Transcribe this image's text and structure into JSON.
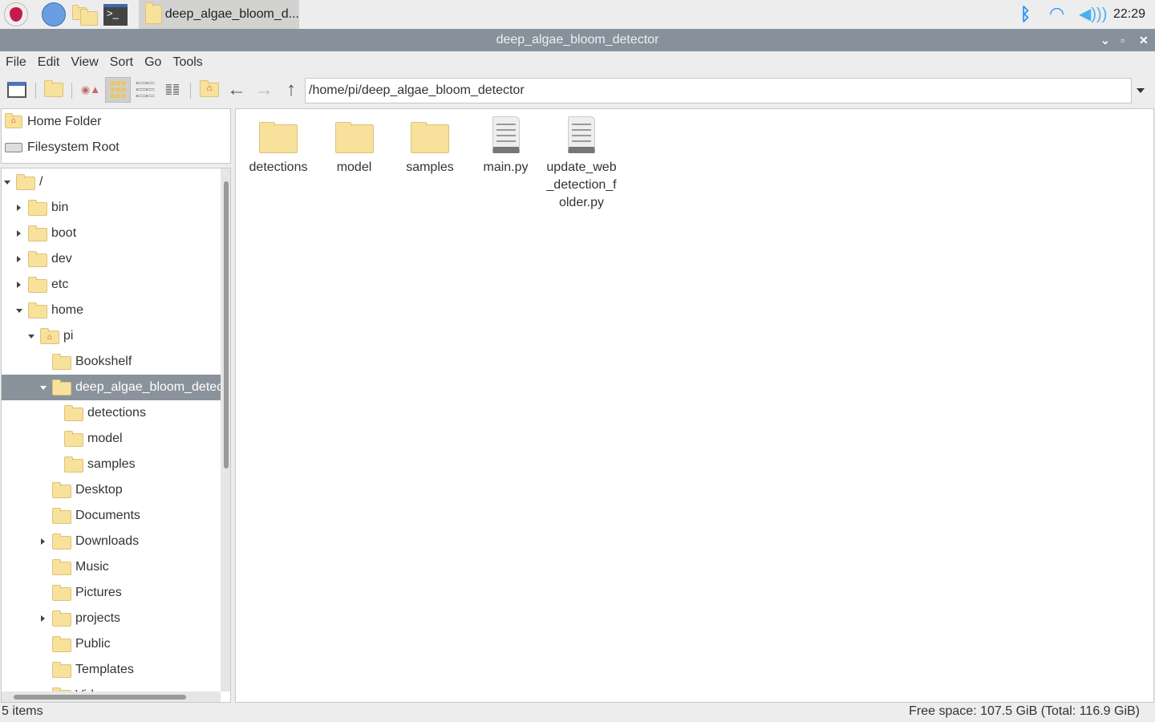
{
  "taskbar": {
    "task_label": "deep_algae_bloom_d...",
    "clock": "22:29",
    "icons": [
      "raspberry-menu-icon",
      "browser-globe-icon",
      "file-manager-icon",
      "terminal-icon"
    ],
    "tray": [
      "bluetooth-icon",
      "wifi-icon",
      "volume-icon"
    ],
    "tray_color": "#1e90ff"
  },
  "window": {
    "title": "deep_algae_bloom_detector",
    "titlebar_color": "#87919b"
  },
  "menu": [
    "File",
    "Edit",
    "View",
    "Sort",
    "Go",
    "Tools"
  ],
  "path": "/home/pi/deep_algae_bloom_detector",
  "places": [
    {
      "label": "Home Folder",
      "icon": "home-folder-icon"
    },
    {
      "label": "Filesystem Root",
      "icon": "drive-icon"
    }
  ],
  "tree": [
    {
      "label": "/",
      "level": 0,
      "exp": "d"
    },
    {
      "label": "bin",
      "level": 1,
      "exp": "r"
    },
    {
      "label": "boot",
      "level": 1,
      "exp": "r"
    },
    {
      "label": "dev",
      "level": 1,
      "exp": "r"
    },
    {
      "label": "etc",
      "level": 1,
      "exp": "r"
    },
    {
      "label": "home",
      "level": 1,
      "exp": "d"
    },
    {
      "label": "pi",
      "level": 2,
      "exp": "d",
      "home": true
    },
    {
      "label": "Bookshelf",
      "level": 3
    },
    {
      "label": "deep_algae_bloom_detector",
      "level": 3,
      "exp": "d",
      "selected": true
    },
    {
      "label": "detections",
      "level": 4
    },
    {
      "label": "model",
      "level": 4
    },
    {
      "label": "samples",
      "level": 4
    },
    {
      "label": "Desktop",
      "level": 3
    },
    {
      "label": "Documents",
      "level": 3
    },
    {
      "label": "Downloads",
      "level": 3,
      "exp": "r"
    },
    {
      "label": "Music",
      "level": 3
    },
    {
      "label": "Pictures",
      "level": 3
    },
    {
      "label": "projects",
      "level": 3,
      "exp": "r"
    },
    {
      "label": "Public",
      "level": 3
    },
    {
      "label": "Templates",
      "level": 3
    },
    {
      "label": "Videos",
      "level": 3
    }
  ],
  "files": [
    {
      "name": "detections",
      "type": "folder"
    },
    {
      "name": "model",
      "type": "folder"
    },
    {
      "name": "samples",
      "type": "folder"
    },
    {
      "name": "main.py",
      "type": "file"
    },
    {
      "name": "update_web_detection_folder.py",
      "type": "file"
    }
  ],
  "status": {
    "items": "5 items",
    "free": "Free space: 107.5 GiB (Total: 116.9 GiB)"
  }
}
